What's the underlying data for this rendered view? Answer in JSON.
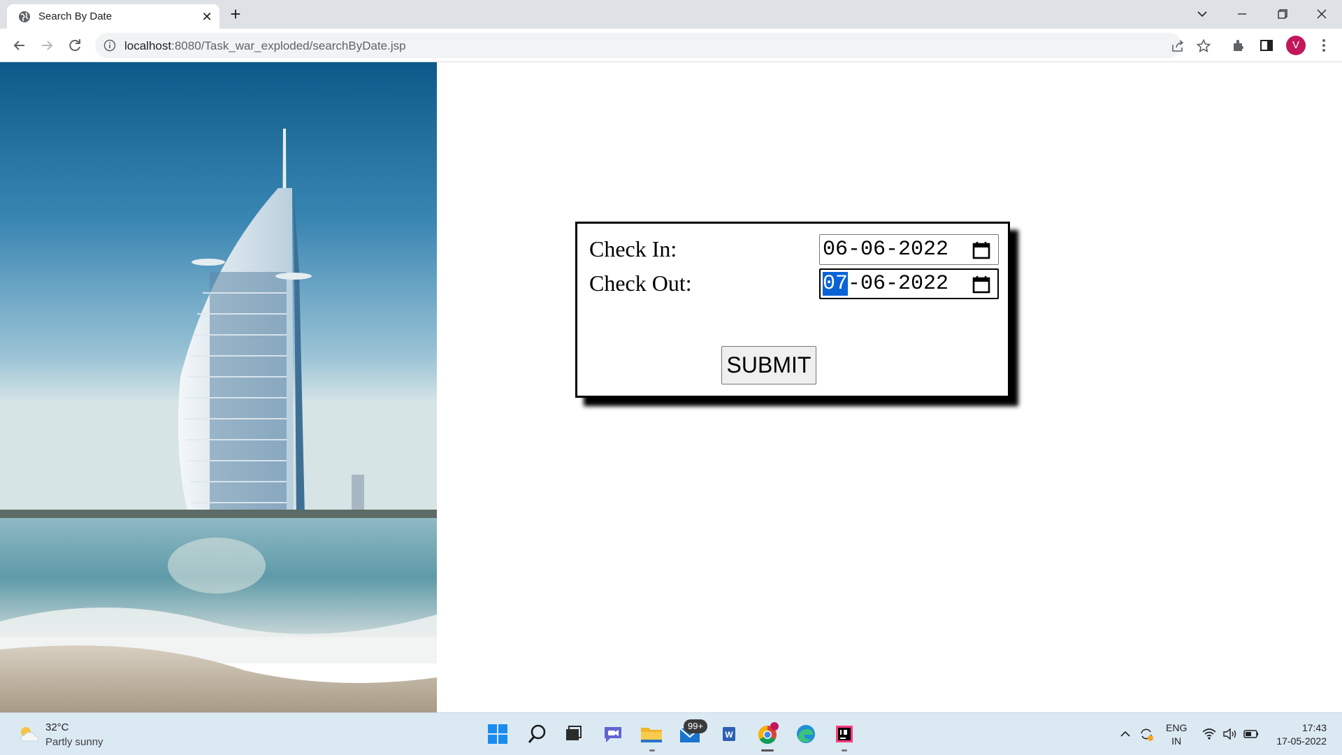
{
  "browser": {
    "tab_title": "Search By Date",
    "url_host": "localhost",
    "url_path": ":8080/Task_war_exploded/searchByDate.jsp",
    "profile_initial": "V"
  },
  "form": {
    "checkin_label": "Check In:",
    "checkin_value": "06-06-2022",
    "checkout_label": "Check Out:",
    "checkout_day": "07",
    "checkout_rest": "-06-2022",
    "submit_label": "SUBMIT"
  },
  "taskbar": {
    "weather_temp": "32°C",
    "weather_desc": "Partly sunny",
    "mail_badge": "99+",
    "lang_line1": "ENG",
    "lang_line2": "IN",
    "time": "17:43",
    "date": "17-05-2022"
  },
  "colors": {
    "selection": "#0a62d6",
    "profile": "#c2185b"
  }
}
